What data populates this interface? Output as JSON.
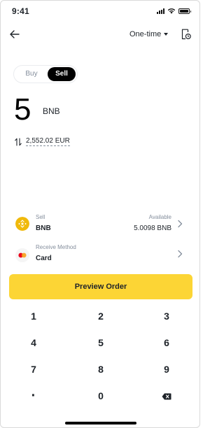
{
  "status_bar": {
    "time": "9:41",
    "icons": [
      "signal-icon",
      "wifi-icon",
      "battery-icon"
    ]
  },
  "header": {
    "back_icon": "arrow-left-icon",
    "frequency_label": "One-time",
    "history_icon": "order-history-icon"
  },
  "trade_toggle": {
    "buy_label": "Buy",
    "sell_label": "Sell",
    "selected": "Sell"
  },
  "amount": {
    "value": "5",
    "unit": "BNB",
    "converted": "2,552.02 EUR",
    "convert_icon": "swap-vertical-icon"
  },
  "sell_row": {
    "label": "Sell",
    "asset": "BNB",
    "available_label": "Available",
    "available_value": "5.0098 BNB",
    "icon": "bnb-coin-icon"
  },
  "receive_row": {
    "label": "Receive Method",
    "method": "Card",
    "icon": "mastercard-icon"
  },
  "preview_button": "Preview Order",
  "keypad": {
    "keys": [
      "1",
      "2",
      "3",
      "4",
      "5",
      "6",
      "7",
      "8",
      "9",
      "·",
      "0",
      "⌫"
    ]
  },
  "colors": {
    "accent": "#FCD535",
    "text_primary": "#1E2329",
    "text_secondary": "#848E9C",
    "bnb": "#F0B90B",
    "mastercard_red": "#EB001B",
    "mastercard_orange": "#F79E1B"
  }
}
